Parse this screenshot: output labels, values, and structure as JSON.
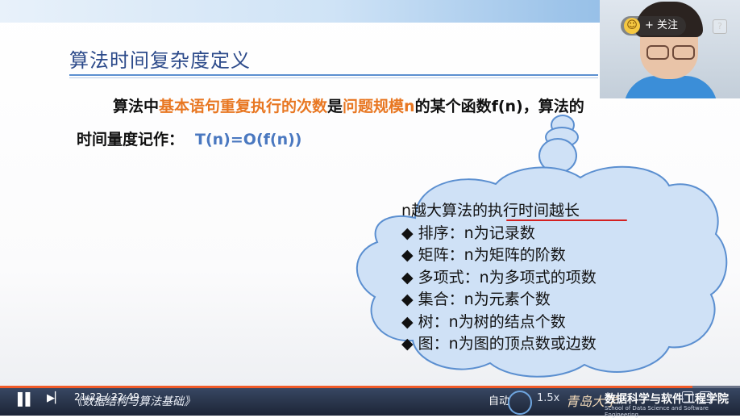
{
  "slide": {
    "title": "算法时间复杂度定义",
    "line1": {
      "p1": "算法中",
      "p2": "基本语句重复执行的次数",
      "p3": "是",
      "p4": "问题规模n",
      "p5": "的某个函数f(n)，算法的"
    },
    "line2": {
      "label": "时间量度记作：",
      "formula": "T(n)=O(f(n))"
    },
    "cloud": {
      "heading": "n越大算法的执行时间越长",
      "items": [
        "◆ 排序：n为记录数",
        "◆ 矩阵：n为矩阵的阶数",
        "◆ 多项式：n为多项式的项数",
        "◆ 集合：n为元素个数",
        "◆ 树：n为树的结点个数",
        "◆ 图：n为图的顶点数或边数"
      ]
    }
  },
  "webcam": {
    "follow_label": "+ 关注",
    "help_label": "?"
  },
  "player": {
    "time": "21:22 / 22:49",
    "course": "《数据结构与算法基础》",
    "auto_label": "自动",
    "speed_label": "1.5x",
    "university": "青岛大学",
    "school": "数据科学与软件工程学院",
    "school_en": "School of Data Science and Software Engineering",
    "progress": 0.936
  },
  "colors": {
    "accent_orange": "#e87722",
    "title_blue": "#2c4a8a",
    "formula_blue": "#4a78c0",
    "cloud_fill": "#cfe1f6",
    "progress": "#f05a28"
  }
}
